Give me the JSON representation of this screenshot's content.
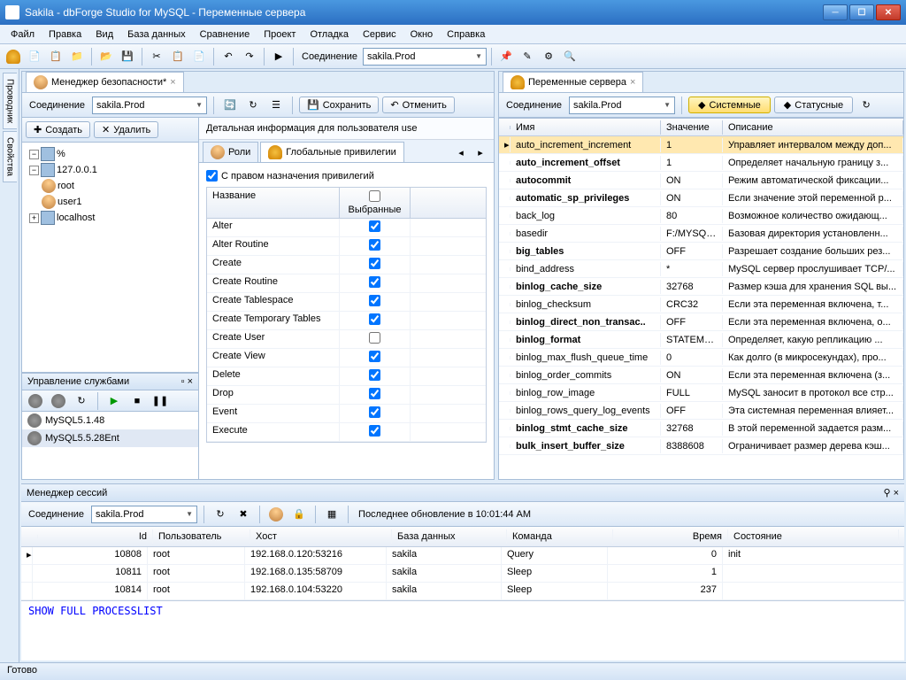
{
  "window": {
    "title": "Sakila - dbForge Studio for MySQL - Переменные сервера"
  },
  "menu": [
    "Файл",
    "Правка",
    "Вид",
    "База данных",
    "Сравнение",
    "Проект",
    "Отладка",
    "Сервис",
    "Окно",
    "Справка"
  ],
  "toolbar": {
    "conn_label": "Соединение",
    "conn_value": "sakila.Prod"
  },
  "left": {
    "tab": "Менеджер безопасности*",
    "conn_label": "Соединение",
    "conn_value": "sakila.Prod",
    "save": "Сохранить",
    "cancel": "Отменить",
    "create": "Создать",
    "delete": "Удалить",
    "tree": {
      "pct": "%",
      "host": "127.0.0.1",
      "u1": "root",
      "u2": "user1",
      "localhost": "localhost"
    },
    "services": {
      "title": "Управление службами",
      "items": [
        "MySQL5.1.48",
        "MySQL5.5.28Ent"
      ]
    },
    "detail_header": "Детальная информация для пользователя use",
    "tabs": {
      "roles": "Роли",
      "globpriv": "Глобальные привилегии"
    },
    "grant_check": "С правом назначения привилегий",
    "grid_hdr": {
      "name": "Название",
      "sel": "Выбранные"
    },
    "privs": [
      "Alter",
      "Alter Routine",
      "Create",
      "Create Routine",
      "Create Tablespace",
      "Create Temporary Tables",
      "Create User",
      "Create View",
      "Delete",
      "Drop",
      "Event",
      "Execute"
    ]
  },
  "right": {
    "tab": "Переменные сервера",
    "conn_label": "Соединение",
    "conn_value": "sakila.Prod",
    "system_btn": "Системные",
    "status_btn": "Статусные",
    "hdr": {
      "name": "Имя",
      "value": "Значение",
      "desc": "Описание"
    },
    "rows": [
      {
        "n": "auto_increment_increment",
        "v": "1",
        "d": "Управляет интервалом между доп...",
        "b": false,
        "sel": true
      },
      {
        "n": "auto_increment_offset",
        "v": "1",
        "d": "Определяет начальную границу з...",
        "b": true
      },
      {
        "n": "autocommit",
        "v": "ON",
        "d": "Режим автоматической фиксации...",
        "b": true
      },
      {
        "n": "automatic_sp_privileges",
        "v": "ON",
        "d": "Если значение этой переменной р...",
        "b": true
      },
      {
        "n": "back_log",
        "v": "80",
        "d": "Возможное количество ожидающ...",
        "b": false
      },
      {
        "n": "basedir",
        "v": "F:/MYSQL...",
        "d": "Базовая директория установленн...",
        "b": false
      },
      {
        "n": "big_tables",
        "v": "OFF",
        "d": "Разрешает создание больших рез...",
        "b": true
      },
      {
        "n": "bind_address",
        "v": "*",
        "d": "MySQL сервер прослушивает TCP/...",
        "b": false
      },
      {
        "n": "binlog_cache_size",
        "v": "32768",
        "d": "Размер кэша для хранения SQL вы...",
        "b": true
      },
      {
        "n": "binlog_checksum",
        "v": "CRC32",
        "d": "Если эта переменная включена, т...",
        "b": false
      },
      {
        "n": "binlog_direct_non_transac..",
        "v": "OFF",
        "d": "Если эта переменная включена, о...",
        "b": true
      },
      {
        "n": "binlog_format",
        "v": "STATEMENT",
        "d": "Определяет, какую репликацию ...",
        "b": true
      },
      {
        "n": "binlog_max_flush_queue_time",
        "v": "0",
        "d": "Как долго (в микросекундах), про...",
        "b": false
      },
      {
        "n": "binlog_order_commits",
        "v": "ON",
        "d": "Если эта переменная включена (з...",
        "b": false
      },
      {
        "n": "binlog_row_image",
        "v": "FULL",
        "d": "MySQL заносит в протокол все стр...",
        "b": false
      },
      {
        "n": "binlog_rows_query_log_events",
        "v": "OFF",
        "d": "Эта системная переменная влияет...",
        "b": false
      },
      {
        "n": "binlog_stmt_cache_size",
        "v": "32768",
        "d": "В этой переменной задается разм...",
        "b": true
      },
      {
        "n": "bulk_insert_buffer_size",
        "v": "8388608",
        "d": "Ограничивает размер дерева кэш...",
        "b": true
      }
    ]
  },
  "sessions": {
    "title": "Менеджер сессий",
    "conn_label": "Соединение",
    "conn_value": "sakila.Prod",
    "update_label": "Последнее обновление в 10:01:44 AM",
    "hdr": {
      "id": "Id",
      "user": "Пользователь",
      "host": "Хост",
      "db": "База данных",
      "cmd": "Команда",
      "time": "Время",
      "state": "Состояние"
    },
    "rows": [
      {
        "id": "10808",
        "user": "root",
        "host": "192.168.0.120:53216",
        "db": "sakila",
        "cmd": "Query",
        "time": "0",
        "state": "init"
      },
      {
        "id": "10811",
        "user": "root",
        "host": "192.168.0.135:58709",
        "db": "sakila",
        "cmd": "Sleep",
        "time": "1",
        "state": ""
      },
      {
        "id": "10814",
        "user": "root",
        "host": "192.168.0.104:53220",
        "db": "sakila",
        "cmd": "Sleep",
        "time": "237",
        "state": ""
      }
    ],
    "sql": "SHOW FULL PROCESSLIST"
  },
  "sidetabs": [
    "Проводник",
    "Свойства"
  ],
  "status": "Готово"
}
